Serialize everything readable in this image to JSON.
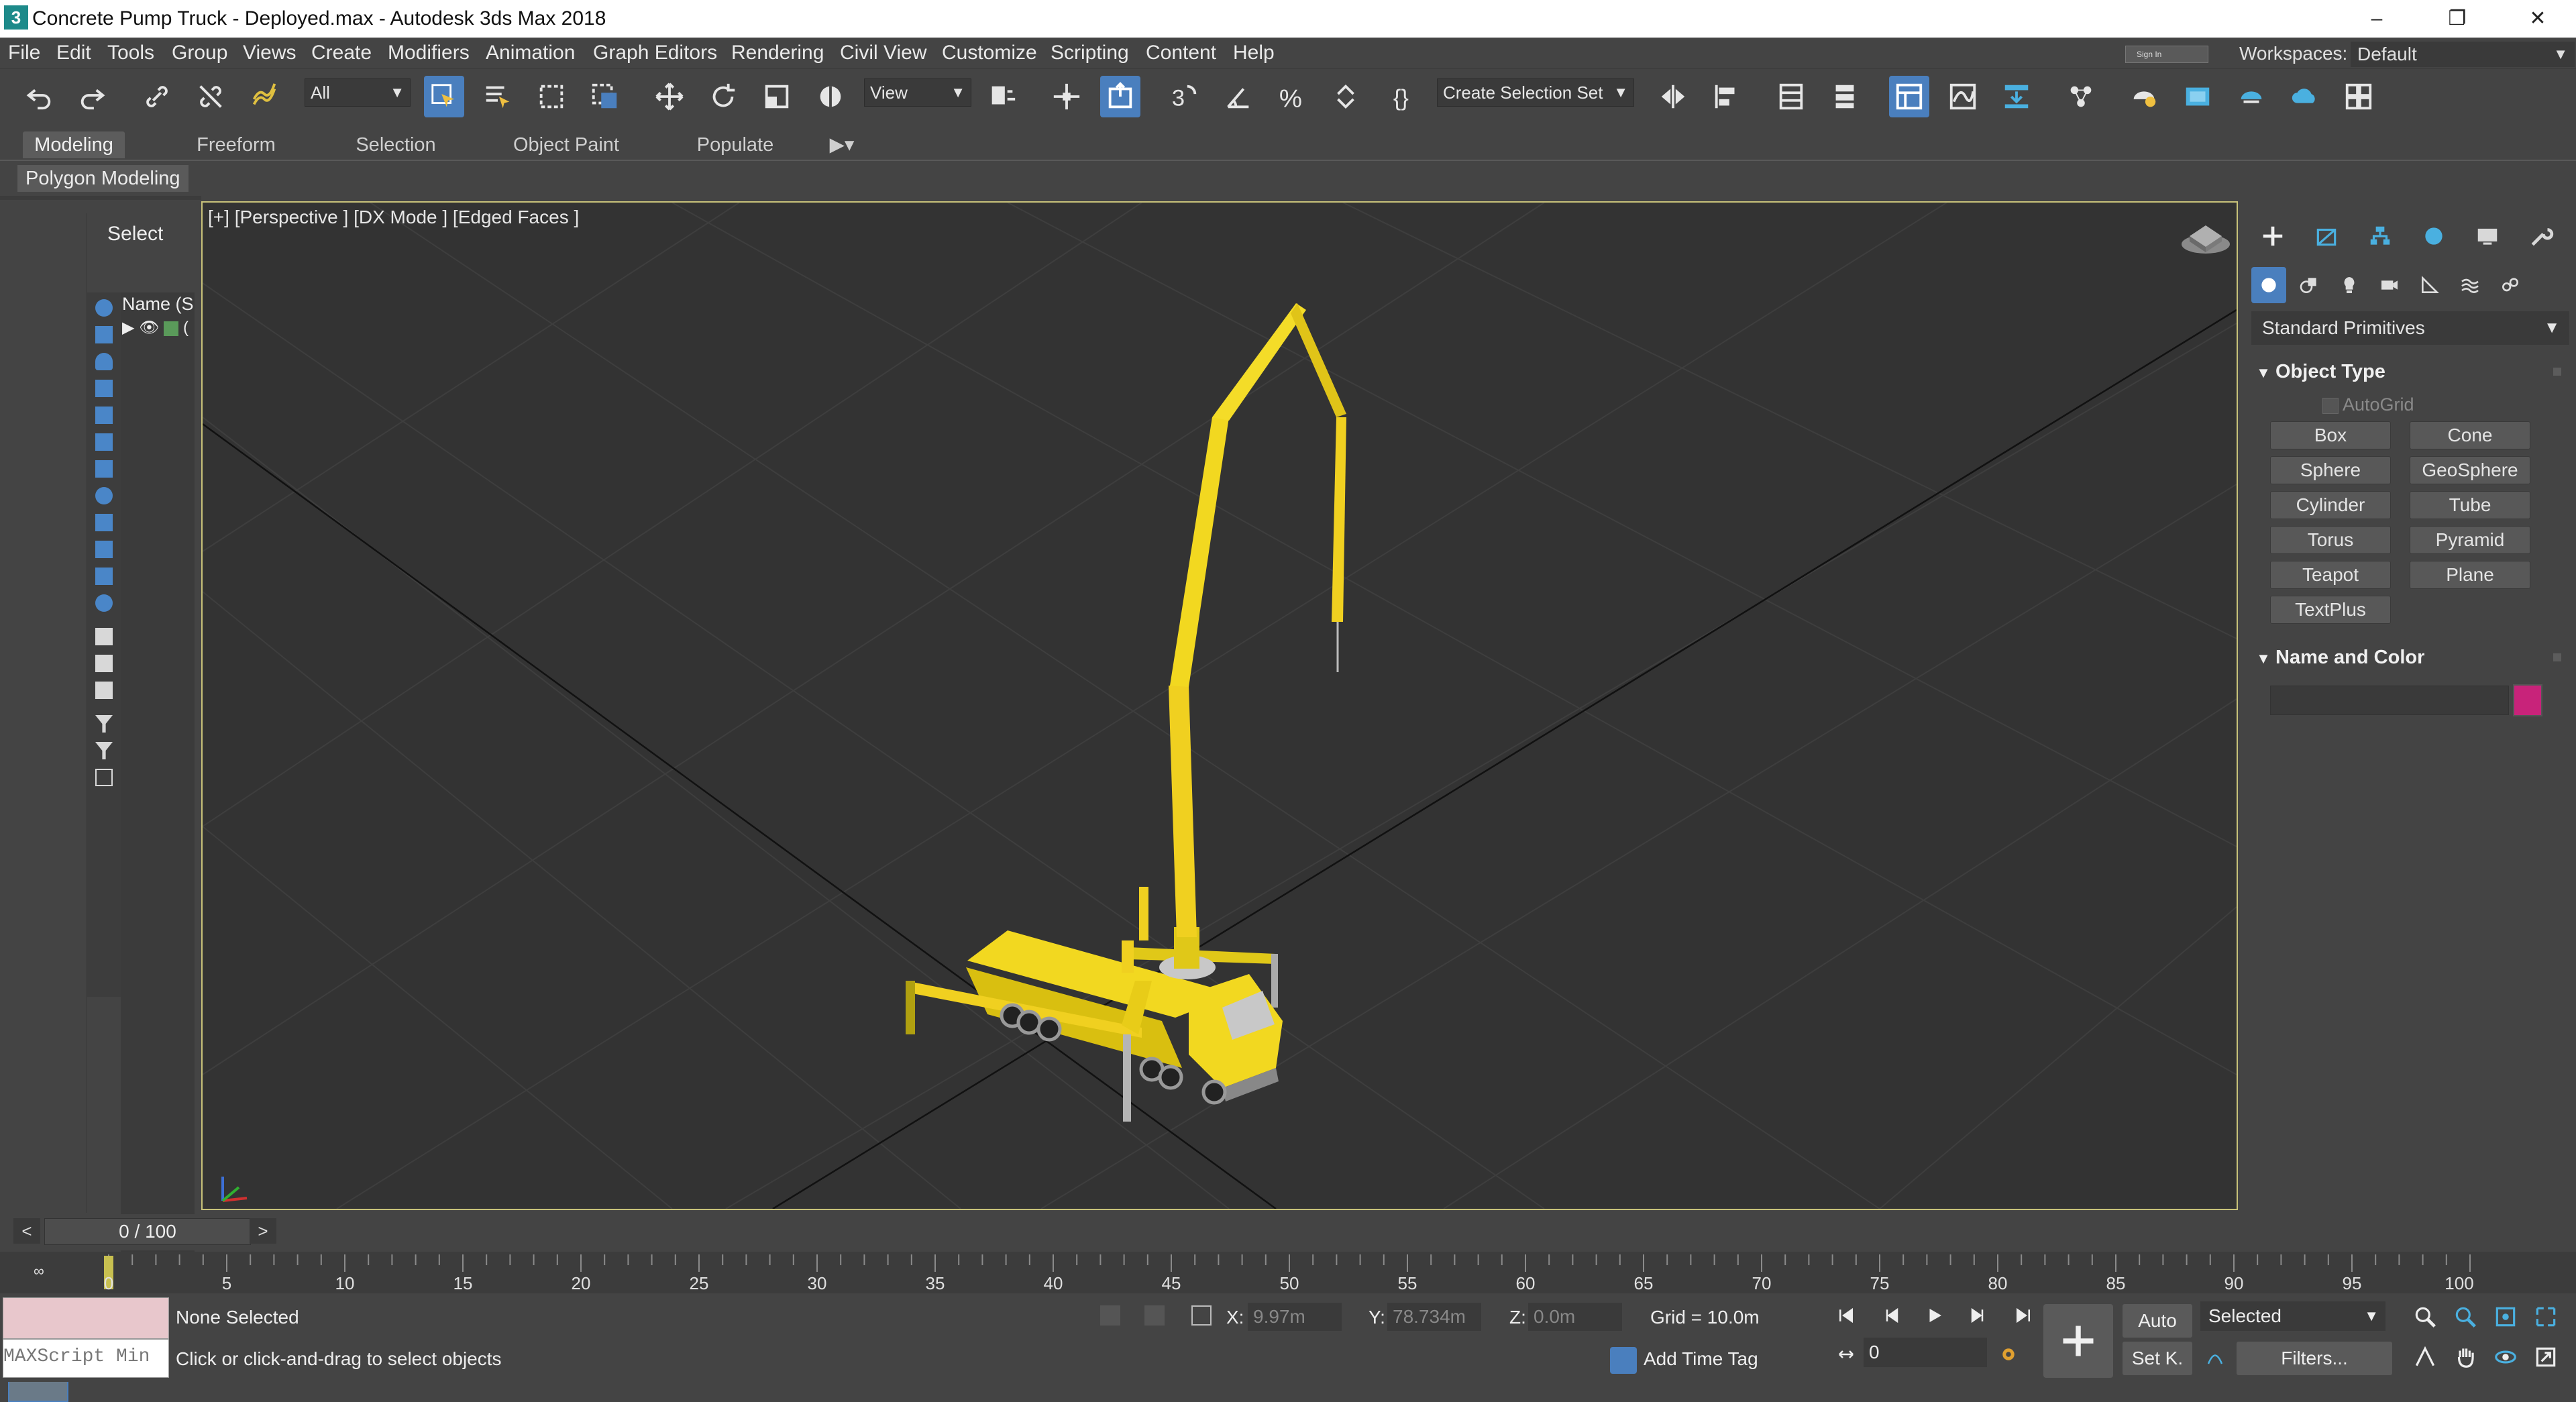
{
  "app": {
    "window_title": "Concrete Pump Truck - Deployed.max - Autodesk 3ds Max 2018",
    "app_icon": "3",
    "window_controls": [
      "minimize-icon",
      "restore-icon",
      "close-icon"
    ]
  },
  "menubar": {
    "items": [
      "File",
      "Edit",
      "Tools",
      "Group",
      "Views",
      "Create",
      "Modifiers",
      "Animation",
      "Graph Editors",
      "Rendering",
      "Civil View",
      "Customize",
      "Scripting",
      "Content",
      "Help"
    ],
    "sign_in": "Sign In",
    "workspaces_label": "Workspaces:",
    "workspace_value": "Default"
  },
  "toolbar": {
    "filter_value": "All",
    "reference_coord": "View",
    "selection_set": "Create Selection Set"
  },
  "ribbon": {
    "tabs": [
      "Modeling",
      "Freeform",
      "Selection",
      "Object Paint",
      "Populate"
    ],
    "active_tab": "Modeling",
    "panel_label": "Polygon Modeling"
  },
  "scene_explorer": {
    "select_label": "Select",
    "column_header": "Name (S",
    "row_text": "(",
    "nav_left": "<",
    "nav_right": ">"
  },
  "viewport": {
    "label": "[+] [Perspective ]  [DX Mode ]  [Edged Faces ]",
    "accent_color": "#c8c27a",
    "model_color": "#f0d020"
  },
  "command_panel": {
    "primitives_dropdown": "Standard Primitives",
    "object_type_title": "Object Type",
    "autogrid_label": "AutoGrid",
    "object_buttons": [
      "Box",
      "Cone",
      "Sphere",
      "GeoSphere",
      "Cylinder",
      "Tube",
      "Torus",
      "Pyramid",
      "Teapot",
      "Plane",
      "TextPlus"
    ],
    "name_color_title": "Name and Color",
    "swatch_color": "#c8237a"
  },
  "timeline": {
    "slider_text": "0 / 100",
    "slider_prev": "<",
    "slider_next": ">",
    "ticks": [
      "0",
      "5",
      "10",
      "15",
      "20",
      "25",
      "30",
      "35",
      "40",
      "45",
      "50",
      "55",
      "60",
      "65",
      "70",
      "75",
      "80",
      "85",
      "90",
      "95",
      "100"
    ]
  },
  "status": {
    "maxscript_placeholder": "MAXScript Min",
    "selection": "None Selected",
    "prompt": "Click or click-and-drag to select objects",
    "x_label": "X:",
    "x_value": "9.97m",
    "y_label": "Y:",
    "y_value": "78.734m",
    "z_label": "Z:",
    "z_value": "0.0m",
    "grid": "Grid = 10.0m",
    "add_time_tag": "Add Time Tag",
    "current_frame": "0",
    "auto_key": "Auto",
    "set_key": "Set K.",
    "key_filter": "Selected",
    "filters": "Filters..."
  }
}
